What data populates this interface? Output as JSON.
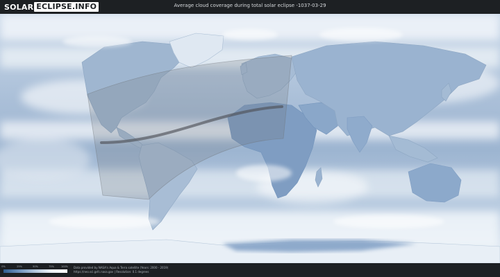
{
  "header": {
    "logo_part1": "SOLAR",
    "logo_part2": "ECLIPSE.INFO",
    "title": "Average cloud coverage during total solar eclipse -1037-03-29"
  },
  "legend": {
    "ticks": [
      "0%",
      "25%",
      "50%",
      "75%",
      "100%"
    ],
    "colors": [
      "#2f5c8e",
      "#6f93bd",
      "#b4c8dd",
      "#eef3f8",
      "#ffffff"
    ]
  },
  "credits": {
    "line1": "Data provided by NASA's Aqua & Terra satellite (Years: 2000 - 2019)",
    "line2": "https://neo.sci.gsfc.nasa.gov | Resolution: 0.1 degrees"
  },
  "colors": {
    "background": "#1d2023",
    "ocean_clear": "#7d9ec4",
    "cloud_white": "#ffffff",
    "eclipse_shadow": "#6f7378",
    "central_line": "#4e5257"
  }
}
